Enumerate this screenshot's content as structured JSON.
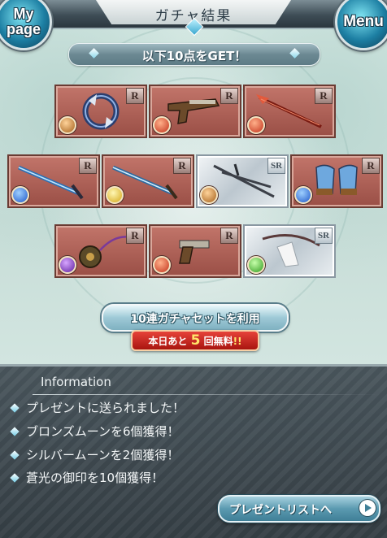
{
  "header": {
    "title": "ガチャ結果",
    "mypage_line1": "My",
    "mypage_line2": "page",
    "menu_label": "Menu"
  },
  "result_banner": "以下10点をGET！",
  "items": [
    {
      "name": "ring-blade",
      "rarity": "R",
      "element": "earth"
    },
    {
      "name": "flintlock-pistol",
      "rarity": "R",
      "element": "fire"
    },
    {
      "name": "crimson-spear",
      "rarity": "R",
      "element": "fire"
    },
    {
      "name": "azure-sword",
      "rarity": "R",
      "element": "water"
    },
    {
      "name": "azure-sword-2",
      "rarity": "R",
      "element": "light"
    },
    {
      "name": "twin-swords",
      "rarity": "SR",
      "element": "earth"
    },
    {
      "name": "gauntlets",
      "rarity": "R",
      "element": "water"
    },
    {
      "name": "flail",
      "rarity": "R",
      "element": "dark"
    },
    {
      "name": "derringer",
      "rarity": "R",
      "element": "fire"
    },
    {
      "name": "white-bow",
      "rarity": "SR",
      "element": "wind"
    }
  ],
  "draw_button": "10連ガチャセットを利用",
  "free_badge": {
    "prefix": "本日あと",
    "count": "5",
    "suffix": "回無料",
    "mark": "!!"
  },
  "info": {
    "title": "Information",
    "lines": [
      "プレゼントに送られました！",
      "ブロンズムーンを6個獲得！",
      "シルバームーンを2個獲得！",
      "蒼光の御印を10個獲得！"
    ],
    "present_button": "プレゼントリストへ"
  },
  "colors": {
    "r_frame": "#9a4f46",
    "sr_frame": "#bcc7cf",
    "accent": "#5b9ab0",
    "badge": "#a9150f"
  }
}
